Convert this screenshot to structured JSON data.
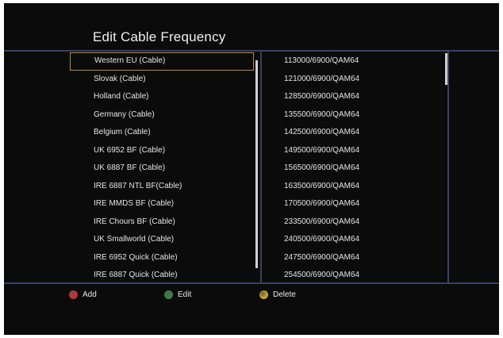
{
  "title": "Edit Cable Frequency",
  "cables": [
    {
      "name": "Western EU (Cable)",
      "freq": "113000/6900/QAM64"
    },
    {
      "name": "Slovak (Cable)",
      "freq": "121000/6900/QAM64"
    },
    {
      "name": "Holland (Cable)",
      "freq": "128500/6900/QAM64"
    },
    {
      "name": "Germany (Cable)",
      "freq": "135500/6900/QAM64"
    },
    {
      "name": "Belgium (Cable)",
      "freq": "142500/6900/QAM64"
    },
    {
      "name": "UK 6952 BF (Cable)",
      "freq": "149500/6900/QAM64"
    },
    {
      "name": "UK 6887 BF (Cable)",
      "freq": "156500/6900/QAM64"
    },
    {
      "name": "IRE 6887 NTL BF(Cable)",
      "freq": "163500/6900/QAM64"
    },
    {
      "name": "IRE MMDS BF (Cable)",
      "freq": "170500/6900/QAM64"
    },
    {
      "name": "IRE Chours BF (Cable)",
      "freq": "233500/6900/QAM64"
    },
    {
      "name": "UK Smallworld (Cable)",
      "freq": "240500/6900/QAM64"
    },
    {
      "name": "IRE 6952 Quick (Cable)",
      "freq": "247500/6900/QAM64"
    },
    {
      "name": "IRE 6887 Quick (Cable)",
      "freq": "254500/6900/QAM64"
    }
  ],
  "footer": {
    "add": {
      "label": "Add",
      "color": "#d42a2a"
    },
    "edit": {
      "label": "Edit",
      "color": "#2f8a3a"
    },
    "delete": {
      "label": "Delete",
      "color": "#c9a320"
    }
  },
  "colors": {
    "background": "#0b0b0c",
    "divider": "#3c3f66",
    "selection_border": "#b98a33"
  }
}
